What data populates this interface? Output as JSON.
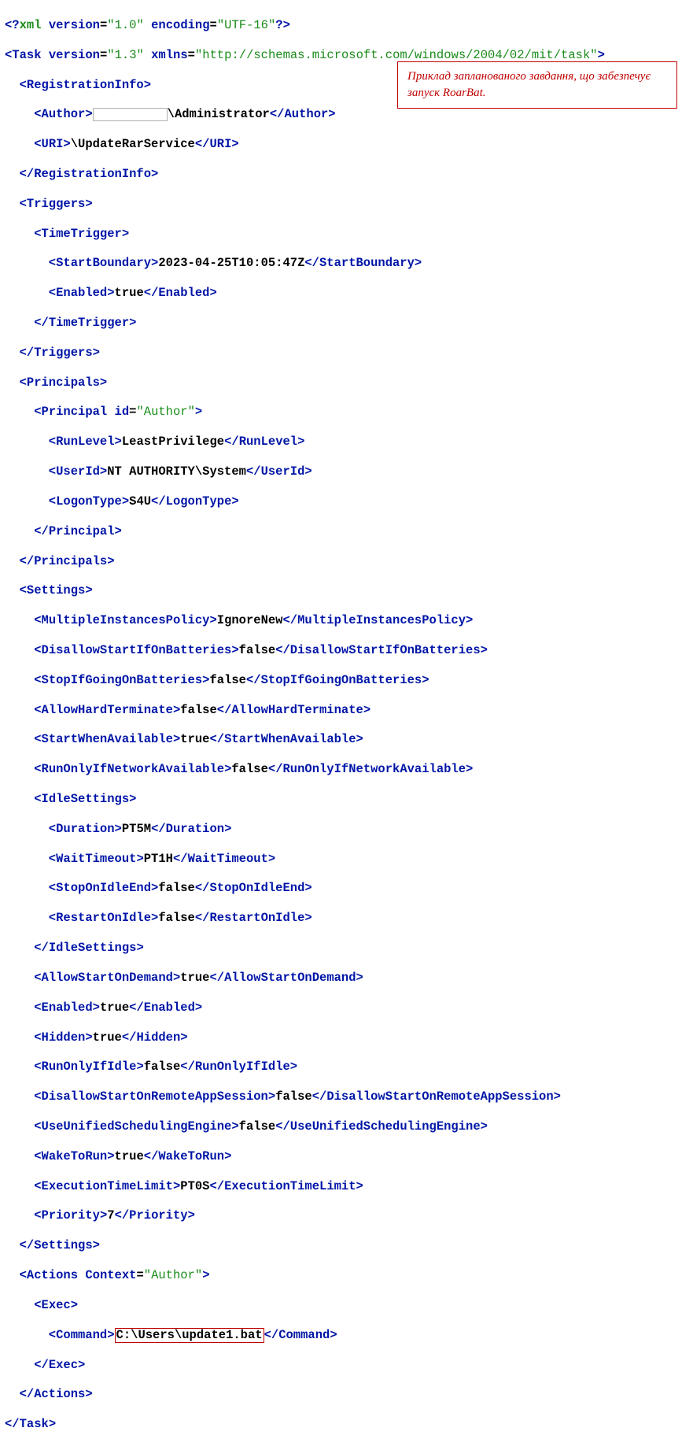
{
  "xml_decl": {
    "version": "1.0",
    "encoding": "UTF-16"
  },
  "task": {
    "version": "1.3",
    "xmlns": "http://schemas.microsoft.com/windows/2004/02/mit/task"
  },
  "reg": {
    "author_suffix": "\\Administrator",
    "uri": "\\UpdateRarService"
  },
  "trigger": {
    "start_boundary": "2023-04-25T10:05:47Z",
    "enabled": "true"
  },
  "principal": {
    "id": "Author",
    "run_level": "LeastPrivilege",
    "user_id": "NT AUTHORITY\\System",
    "logon_type": "S4U"
  },
  "settings": {
    "multiple_instances": "IgnoreNew",
    "disallow_start_batt": "false",
    "stop_going_batt": "false",
    "allow_hard_term": "false",
    "start_when_avail": "true",
    "run_only_net": "false",
    "idle": {
      "duration": "PT5M",
      "wait_timeout": "PT1H",
      "stop_on_idle_end": "false",
      "restart_on_idle": "false"
    },
    "allow_start_demand": "true",
    "enabled": "true",
    "hidden": "true",
    "run_only_idle": "false",
    "disallow_remote": "false",
    "unified_engine": "false",
    "wake_to_run": "true",
    "exec_limit": "PT0S",
    "priority": "7"
  },
  "actions": {
    "context": "Author",
    "command": "C:\\Users\\update1.bat"
  },
  "annotation": "Приклад запланованого завдання, що забезпечує запуск RoarBat.",
  "t": {
    "xml": "xml",
    "version": "version",
    "encoding": "encoding",
    "Task": "Task",
    "xmlns": "xmlns",
    "RegistrationInfo": "RegistrationInfo",
    "Author": "Author",
    "URI": "URI",
    "Triggers": "Triggers",
    "TimeTrigger": "TimeTrigger",
    "StartBoundary": "StartBoundary",
    "Enabled": "Enabled",
    "Principals": "Principals",
    "Principal": "Principal",
    "id": "id",
    "RunLevel": "RunLevel",
    "UserId": "UserId",
    "LogonType": "LogonType",
    "Settings": "Settings",
    "MultipleInstancesPolicy": "MultipleInstancesPolicy",
    "DisallowStartIfOnBatteries": "DisallowStartIfOnBatteries",
    "StopIfGoingOnBatteries": "StopIfGoingOnBatteries",
    "AllowHardTerminate": "AllowHardTerminate",
    "StartWhenAvailable": "StartWhenAvailable",
    "RunOnlyIfNetworkAvailable": "RunOnlyIfNetworkAvailable",
    "IdleSettings": "IdleSettings",
    "Duration": "Duration",
    "WaitTimeout": "WaitTimeout",
    "StopOnIdleEnd": "StopOnIdleEnd",
    "RestartOnIdle": "RestartOnIdle",
    "AllowStartOnDemand": "AllowStartOnDemand",
    "Hidden": "Hidden",
    "RunOnlyIfIdle": "RunOnlyIfIdle",
    "DisallowStartOnRemoteAppSession": "DisallowStartOnRemoteAppSession",
    "UseUnifiedSchedulingEngine": "UseUnifiedSchedulingEngine",
    "WakeToRun": "WakeToRun",
    "ExecutionTimeLimit": "ExecutionTimeLimit",
    "Priority": "Priority",
    "Actions": "Actions",
    "Context": "Context",
    "Exec": "Exec",
    "Command": "Command"
  }
}
